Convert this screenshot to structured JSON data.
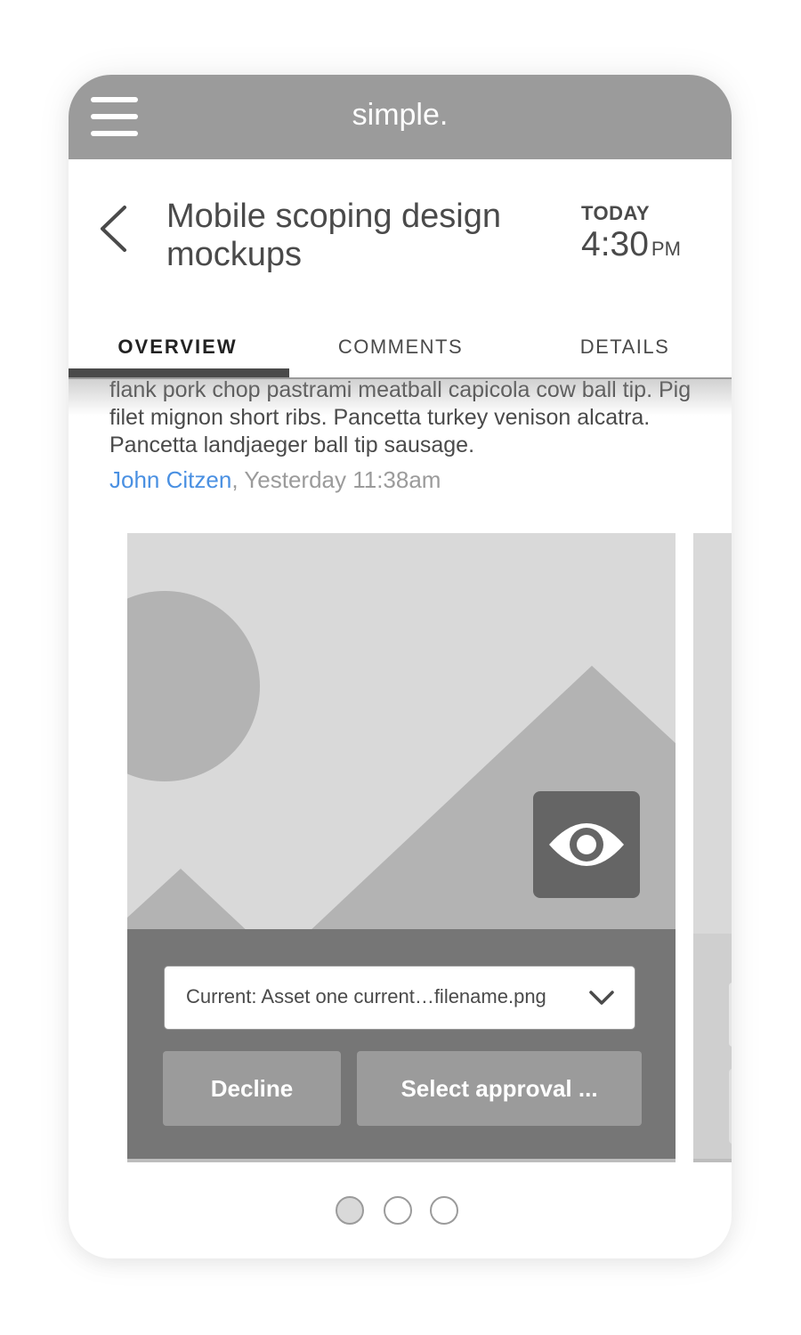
{
  "app": {
    "title": "simple."
  },
  "header": {
    "title": "Mobile scoping design mockups",
    "day": "TODAY",
    "time": "4:30",
    "ampm": "PM"
  },
  "tabs": [
    {
      "label": "OVERVIEW",
      "active": true
    },
    {
      "label": "COMMENTS",
      "active": false
    },
    {
      "label": "DETAILS",
      "active": false
    }
  ],
  "comment": {
    "text": "flank pork chop pastrami meatball capicola cow ball tip. Pig filet mignon short ribs. Pancetta turkey venison alcatra. Pancetta landjaeger ball tip sausage.",
    "author": "John Citzen",
    "separator": ",",
    "timestamp": "Yesterday 11:38am"
  },
  "asset_card": {
    "select_prefix": "Current:",
    "select_value": "Asset one current…filename.png",
    "decline_label": "Decline",
    "approve_label": "Select approval ..."
  },
  "pagination": {
    "pages": 3,
    "current": 1
  },
  "icons": {
    "menu": "hamburger-menu-icon",
    "back": "chevron-left-icon",
    "preview": "eye-icon",
    "dropdown": "chevron-down-icon"
  },
  "colors": {
    "appbar": "#9b9b9b",
    "link": "#4a90e2",
    "text": "#4a4a4a"
  }
}
